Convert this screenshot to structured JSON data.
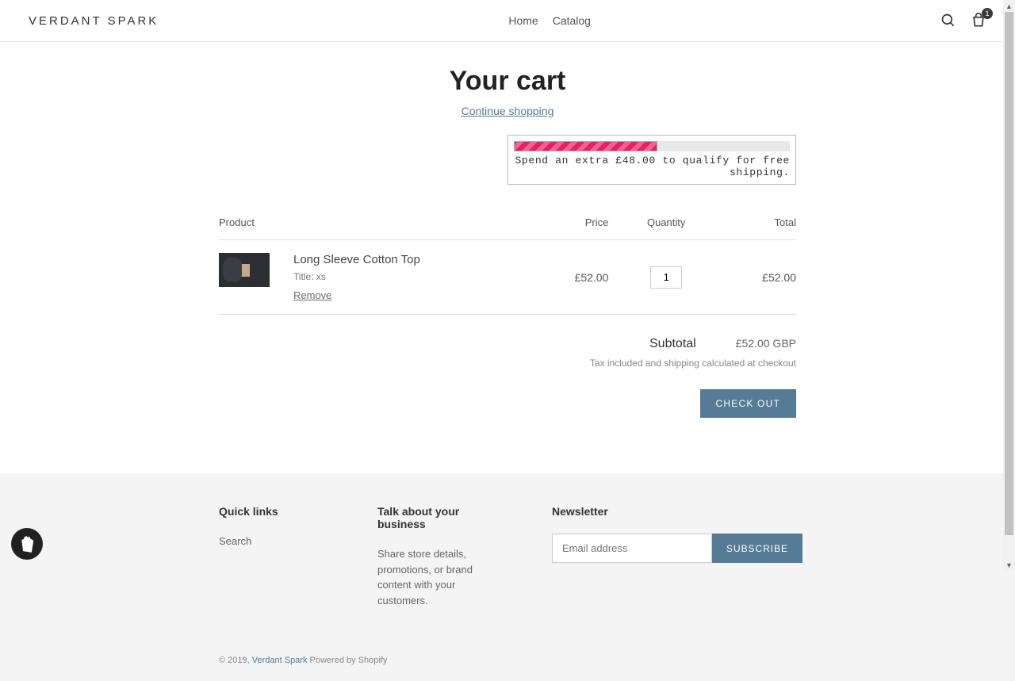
{
  "header": {
    "logo": "VERDANT SPARK",
    "nav": {
      "home": "Home",
      "catalog": "Catalog"
    },
    "cart_count": "1"
  },
  "page": {
    "title": "Your cart",
    "continue_shopping": "Continue shopping",
    "shipping_message": "Spend an extra £48.00 to qualify for free shipping.",
    "progress_percent": 52
  },
  "table": {
    "headers": {
      "product": "Product",
      "price": "Price",
      "quantity": "Quantity",
      "total": "Total"
    },
    "item": {
      "name": "Long Sleeve Cotton Top",
      "variant": "Title: xs",
      "remove": "Remove",
      "price": "£52.00",
      "quantity": "1",
      "total": "£52.00"
    }
  },
  "totals": {
    "subtotal_label": "Subtotal",
    "subtotal_value": "£52.00 GBP",
    "tax_note": "Tax included and shipping calculated at checkout",
    "checkout": "CHECK OUT"
  },
  "footer": {
    "quick_title": "Quick links",
    "search": "Search",
    "about_title": "Talk about your business",
    "about_text": "Share store details, promotions, or brand content with your customers.",
    "news_title": "Newsletter",
    "email_placeholder": "Email address",
    "subscribe": "SUBSCRIBE",
    "copyright_prefix": "© 2019, ",
    "copyright_store": "Verdant Spark",
    "copyright_powered": " Powered by Shopify"
  }
}
